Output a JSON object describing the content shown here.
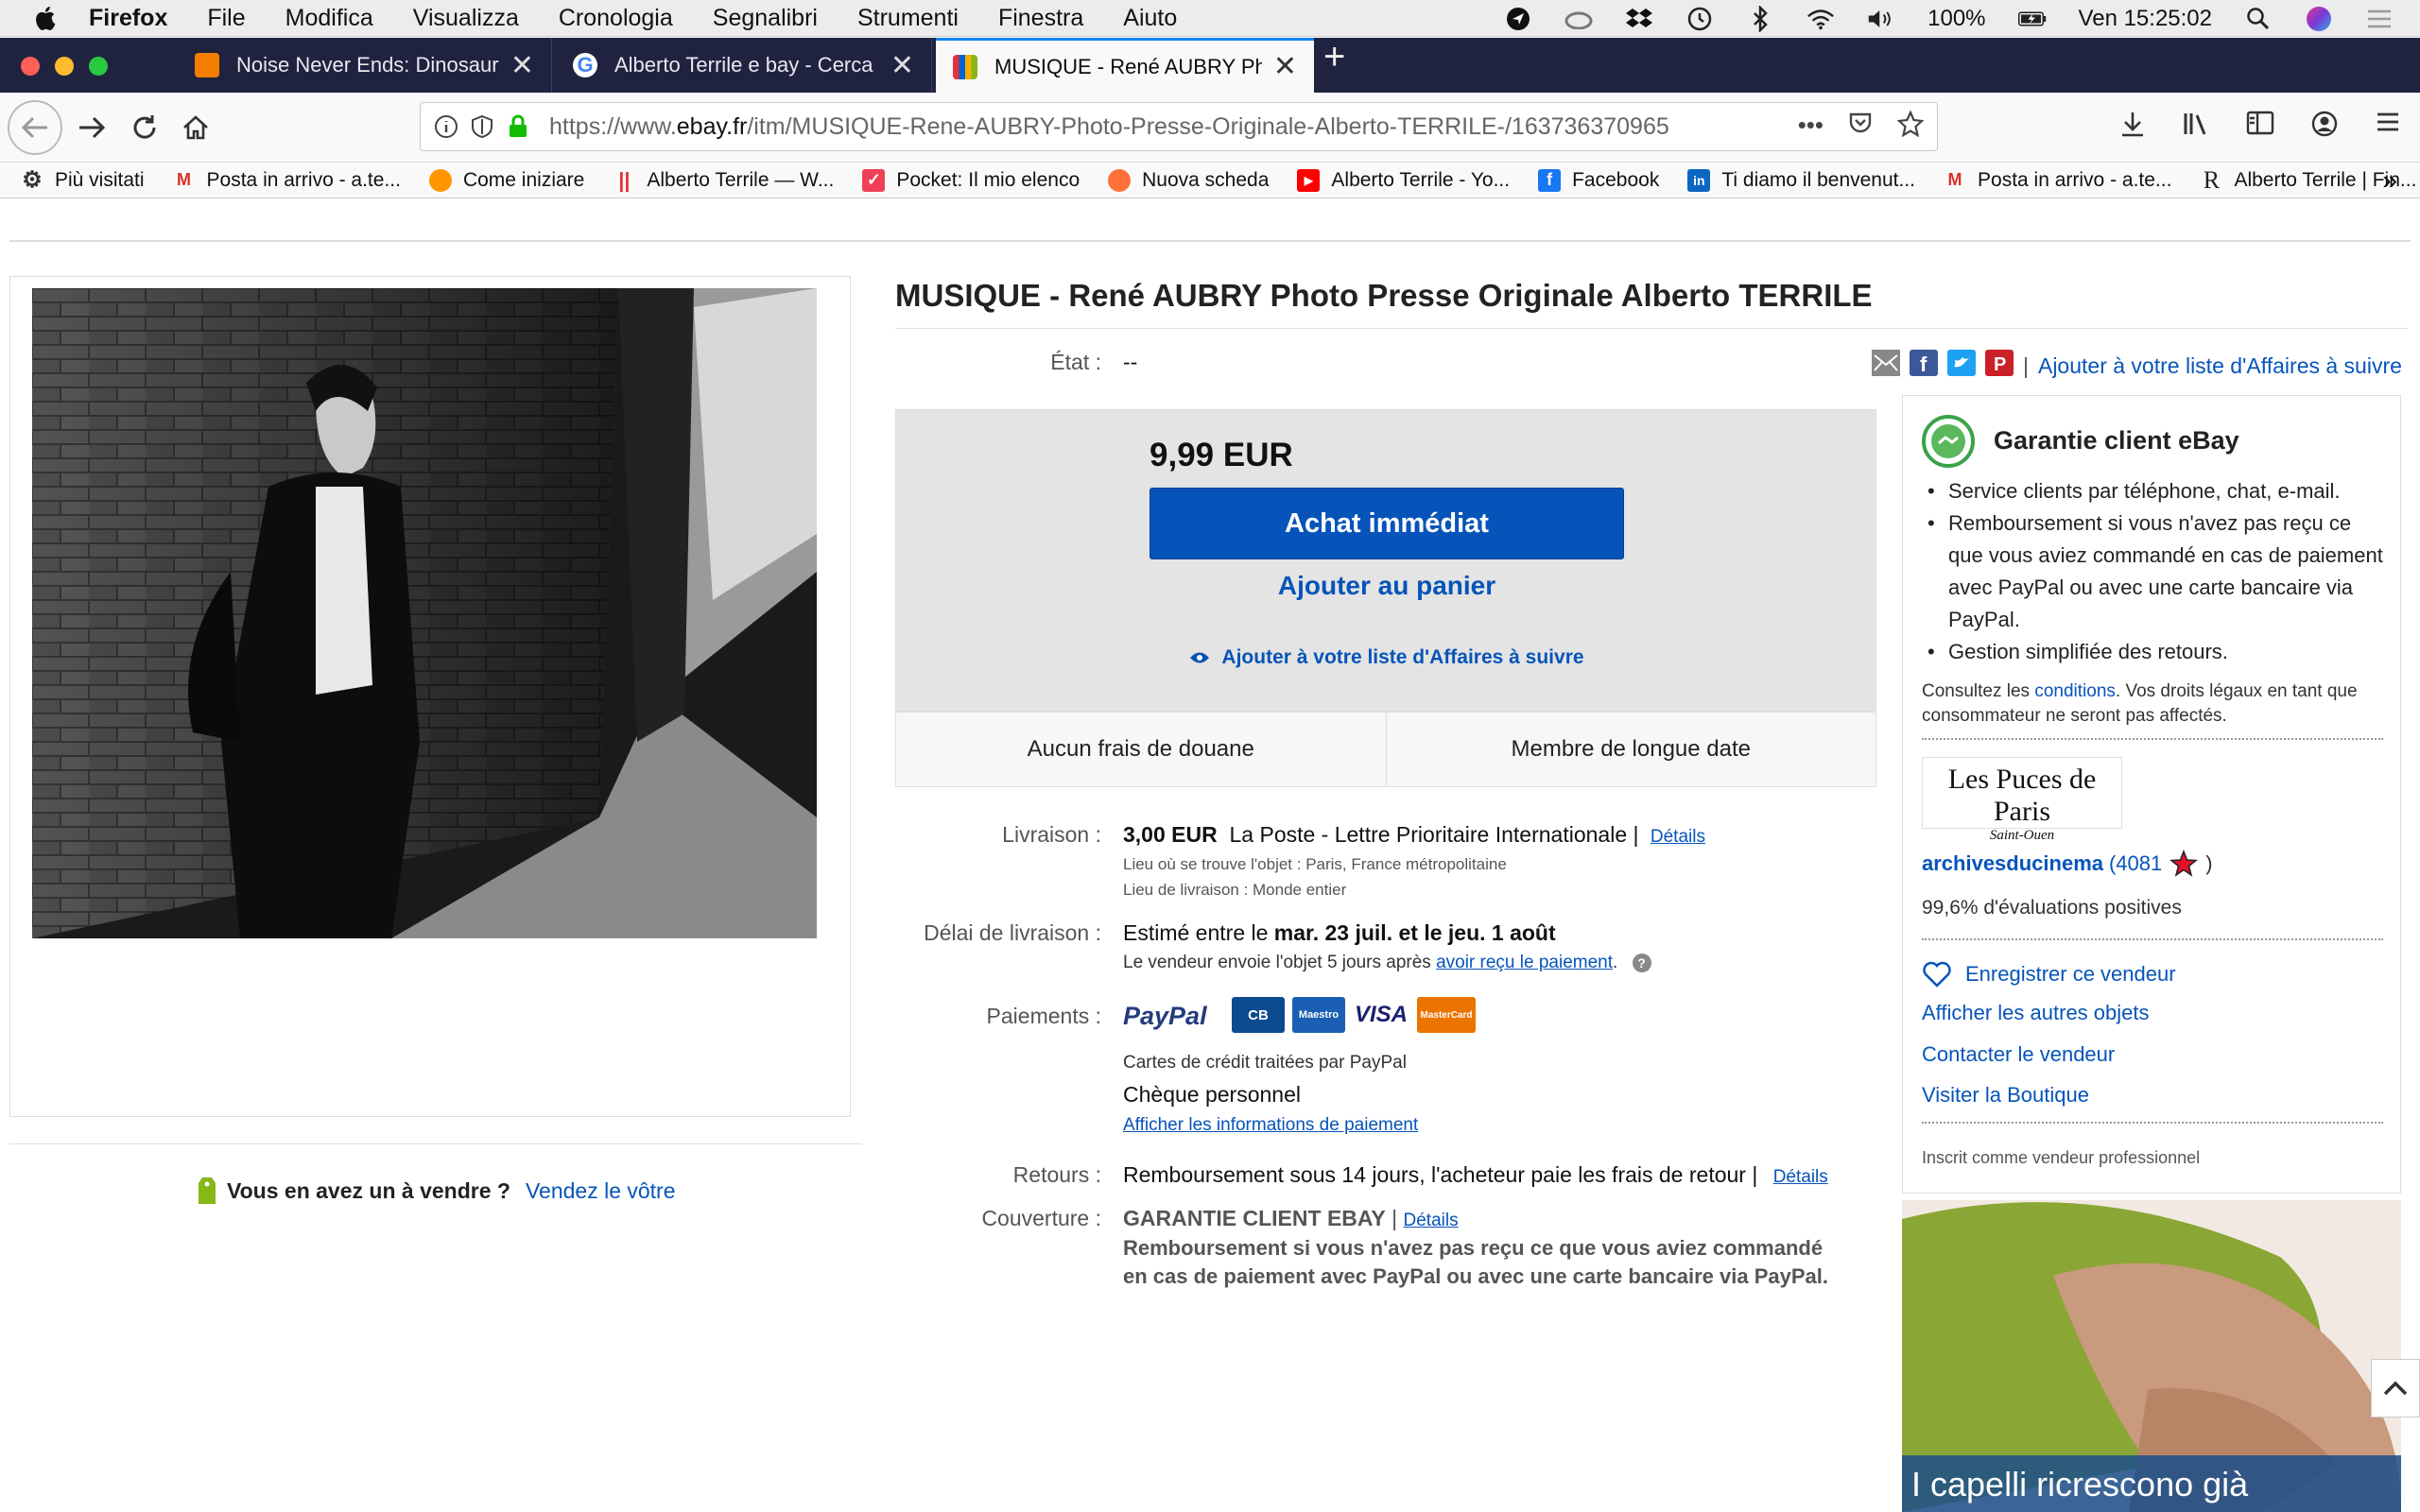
{
  "menubar": {
    "app": "Firefox",
    "items": [
      "File",
      "Modifica",
      "Visualizza",
      "Cronologia",
      "Segnalibri",
      "Strumenti",
      "Finestra",
      "Aiuto"
    ],
    "battery": "100%",
    "clock": "Ven 15:25:02"
  },
  "tabs": [
    {
      "title": "Noise Never Ends: Dinosaur Jr.",
      "favicon_color": "#f57d00"
    },
    {
      "title": "Alberto Terrile e bay - Cerca co",
      "favicon_color": "#4285f4"
    },
    {
      "title": "MUSIQUE - René AUBRY Photo",
      "favicon_color": "#e53238"
    }
  ],
  "url": {
    "prefix": "https://www.",
    "domain": "ebay.fr",
    "path": "/itm/MUSIQUE-Rene-AUBRY-Photo-Presse-Originale-Alberto-TERRILE-/163736370965",
    "more": "•••"
  },
  "bookmarks": [
    {
      "label": "Più visitati"
    },
    {
      "label": "Posta in arrivo - a.te..."
    },
    {
      "label": "Come iniziare"
    },
    {
      "label": "Alberto Terrile — W..."
    },
    {
      "label": "Pocket: Il mio elenco"
    },
    {
      "label": "Nuova scheda"
    },
    {
      "label": "Alberto Terrile - Yo..."
    },
    {
      "label": "Facebook"
    },
    {
      "label": "Ti diamo il benvenut..."
    },
    {
      "label": "Posta in arrivo - a.te..."
    },
    {
      "label": "Alberto Terrile | Fin..."
    }
  ],
  "listing": {
    "title": "MUSIQUE - René AUBRY Photo Presse Originale Alberto TERRILE",
    "etat_label": "État :",
    "etat_value": "--",
    "watch_link": "Ajouter à votre liste d'Affaires à suivre",
    "price": "9,99 EUR",
    "buy_now": "Achat immédiat",
    "add_cart": "Ajouter au panier",
    "watch": "Ajouter à votre liste d'Affaires à suivre",
    "badge1": "Aucun frais de douane",
    "badge2": "Membre de longue date",
    "sell_question": "Vous en avez un à vendre ?",
    "sell_link": "Vendez le vôtre"
  },
  "shipping": {
    "label": "Livraison :",
    "price": "3,00 EUR",
    "method": "La Poste - Lettre Prioritaire Internationale |",
    "details": "Détails",
    "location": "Lieu où se trouve l'objet :  Paris, France métropolitaine",
    "destination": "Lieu de livraison :  Monde entier"
  },
  "delivery": {
    "label": "Délai de livraison :",
    "estimate_prefix": "Estimé entre le",
    "estimate_dates": "mar. 23 juil. et le jeu. 1 août",
    "note_prefix": "Le vendeur envoie l'objet 5 jours après",
    "note_link": "avoir reçu le paiement"
  },
  "payments": {
    "label": "Paiements :",
    "paypal": "PayPal",
    "cards": [
      "CB",
      "Maestro",
      "VISA",
      "MasterCard"
    ],
    "card_note": "Cartes de crédit traitées par PayPal",
    "cheque": "Chèque personnel",
    "info_link": "Afficher les informations de paiement"
  },
  "returns": {
    "label": "Retours :",
    "text": "Remboursement sous 14 jours, l'acheteur paie les frais de retour |",
    "details": "Détails"
  },
  "coverage": {
    "label": "Couverture :",
    "title": "GARANTIE CLIENT EBAY",
    "details": "Détails",
    "line1": "Remboursement si vous n'avez pas reçu ce que vous aviez commandé",
    "line2": "en cas de paiement avec PayPal ou avec une carte bancaire via PayPal."
  },
  "guarantee": {
    "title": "Garantie client eBay",
    "bullets": [
      "Service clients par téléphone, chat, e-mail.",
      "Remboursement si vous n'avez pas reçu ce que vous aviez commandé en cas de paiement avec PayPal ou avec une carte bancaire via PayPal.",
      "Gestion simplifiée des retours."
    ],
    "legal_prefix": "Consultez les",
    "legal_link": "conditions",
    "legal_suffix": ". Vos droits légaux en tant que consommateur ne seront pas affectés."
  },
  "seller": {
    "logo_line1": "Les Puces de Paris",
    "logo_line2": "Saint-Ouen",
    "name": "archivesducinema",
    "score": "(4081",
    "score_close": ")",
    "positive": "99,6% d'évaluations positives",
    "save": "Enregistrer ce vendeur",
    "other_items": "Afficher les autres objets",
    "contact": "Contacter le vendeur",
    "store": "Visiter la Boutique",
    "pro": "Inscrit comme vendeur professionnel"
  },
  "ad": {
    "text": "I capelli ricrescono già"
  },
  "colors": {
    "ebay_blue": "#0654ba",
    "tab_bg": "#202340",
    "accent": "#0a84ff"
  }
}
